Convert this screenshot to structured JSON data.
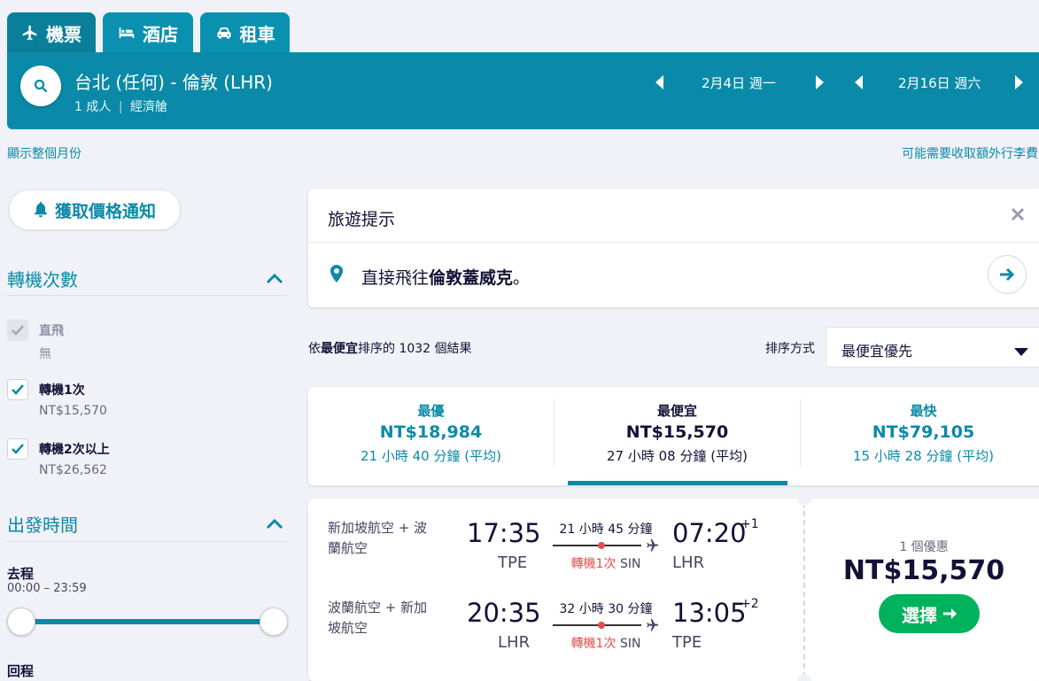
{
  "tabs": [
    {
      "label": "機票",
      "icon": "plane-icon"
    },
    {
      "label": "酒店",
      "icon": "bed-icon"
    },
    {
      "label": "租車",
      "icon": "car-icon"
    }
  ],
  "search": {
    "route": "台北 (任何) - 倫敦 (LHR)",
    "passengers": "1 成人",
    "cabin": "經濟艙",
    "depart_date": "2月4日 週一",
    "return_date": "2月16日 週六"
  },
  "links": {
    "show_month": "顯示整個月份",
    "baggage_note": "可能需要收取額外行李費"
  },
  "sidebar": {
    "price_alert": "獲取價格通知",
    "stops": {
      "title": "轉機次數",
      "options": [
        {
          "label": "直飛",
          "price": "無",
          "checked": true,
          "disabled": true
        },
        {
          "label": "轉機1次",
          "price": "NT$15,570",
          "checked": true,
          "disabled": false
        },
        {
          "label": "轉機2次以上",
          "price": "NT$26,562",
          "checked": true,
          "disabled": false
        }
      ]
    },
    "departure_time": {
      "title": "出發時間",
      "outbound_label": "去程",
      "outbound_range": "00:00 – 23:59",
      "return_label": "回程"
    }
  },
  "tip": {
    "title": "旅遊提示",
    "text_prefix": "直接飛往",
    "text_bold": "倫敦蓋威克",
    "text_suffix": "。"
  },
  "results": {
    "count_prefix": "依",
    "count_bold": "最便宜",
    "count_suffix": "排序的 1032 個結果",
    "sort_label": "排序方式",
    "sort_value": "最便宜優先"
  },
  "summary": [
    {
      "label": "最優",
      "price": "NT$18,984",
      "duration": "21 小時 40 分鐘 (平均)"
    },
    {
      "label": "最便宜",
      "price": "NT$15,570",
      "duration": "27 小時 08 分鐘 (平均)"
    },
    {
      "label": "最快",
      "price": "NT$79,105",
      "duration": "15 小時 28 分鐘 (平均)"
    }
  ],
  "flight": {
    "legs": [
      {
        "airline": "新加坡航空 + 波蘭航空",
        "depart_time": "17:35",
        "depart_code": "TPE",
        "duration": "21 小時 45 分鐘",
        "stops": "轉機1次",
        "stop_code": "SIN",
        "arrive_time": "07:20",
        "arrive_code": "LHR",
        "day_offset": "+1"
      },
      {
        "airline": "波蘭航空 + 新加坡航空",
        "depart_time": "20:35",
        "depart_code": "LHR",
        "duration": "32 小時 30 分鐘",
        "stops": "轉機1次",
        "stop_code": "SIN",
        "arrive_time": "13:05",
        "arrive_code": "TPE",
        "day_offset": "+2"
      }
    ],
    "deals": "1 個優惠",
    "price": "NT$15,570",
    "select_label": "選擇"
  },
  "colors": {
    "brand": "#0a8aa8",
    "select": "#00b25b",
    "stop": "#e74b4b"
  }
}
